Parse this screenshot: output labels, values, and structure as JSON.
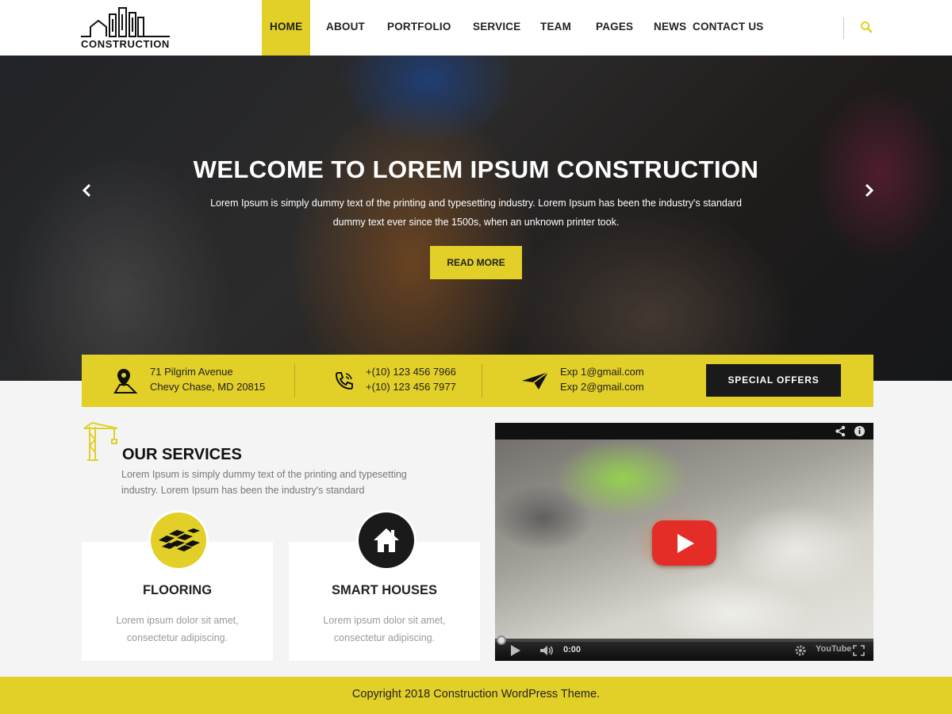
{
  "brand": {
    "logo_text": "CONSTRUCTION"
  },
  "nav": {
    "items": [
      {
        "label": "HOME",
        "active": true
      },
      {
        "label": "ABOUT"
      },
      {
        "label": "PORTFOLIO"
      },
      {
        "label": "SERVICE"
      },
      {
        "label": "TEAM"
      },
      {
        "label": "PAGES"
      },
      {
        "label": "NEWS"
      },
      {
        "label": "CONTACT US"
      }
    ],
    "search_icon": "search-icon"
  },
  "hero": {
    "title": "WELCOME  TO LOREM IPSUM CONSTRUCTION",
    "subtitle": "Lorem Ipsum is simply dummy text of the printing and typesetting industry. Lorem Ipsum has been the industry's standard dummy text ever since the 1500s, when an unknown printer took.",
    "button": "READ MORE"
  },
  "contact": {
    "address_line1": "71 Pilgrim Avenue",
    "address_line2": "Chevy Chase, MD 20815",
    "phone1": "+(10) 123 456 7966",
    "phone2": "+(10) 123 456 7977",
    "email1": "Exp 1@gmail.com",
    "email2": "Exp 2@gmail.com",
    "offer_button": "SPECIAL OFFERS"
  },
  "services": {
    "title": "OUR SERVICES",
    "description": "Lorem Ipsum is simply dummy text of the printing and typesetting industry. Lorem Ipsum has been the industry's standard",
    "cards": [
      {
        "title": "FLOORING",
        "desc": "Lorem ipsum dolor sit amet, consectetur adipiscing.",
        "icon": "flooring-icon",
        "circle_color": "#e2cf27"
      },
      {
        "title": "SMART HOUSES",
        "desc": "Lorem ipsum dolor sit amet, consectetur adipiscing.",
        "icon": "house-icon",
        "circle_color": "#1a1a1a"
      }
    ]
  },
  "video": {
    "time": "0:00",
    "brand": "YouTube"
  },
  "footer": {
    "copyright": "Copyright 2018 Construction WordPress Theme."
  },
  "colors": {
    "accent": "#e2cf27",
    "dark": "#1a1a1a",
    "youtube_red": "#e52d27"
  }
}
